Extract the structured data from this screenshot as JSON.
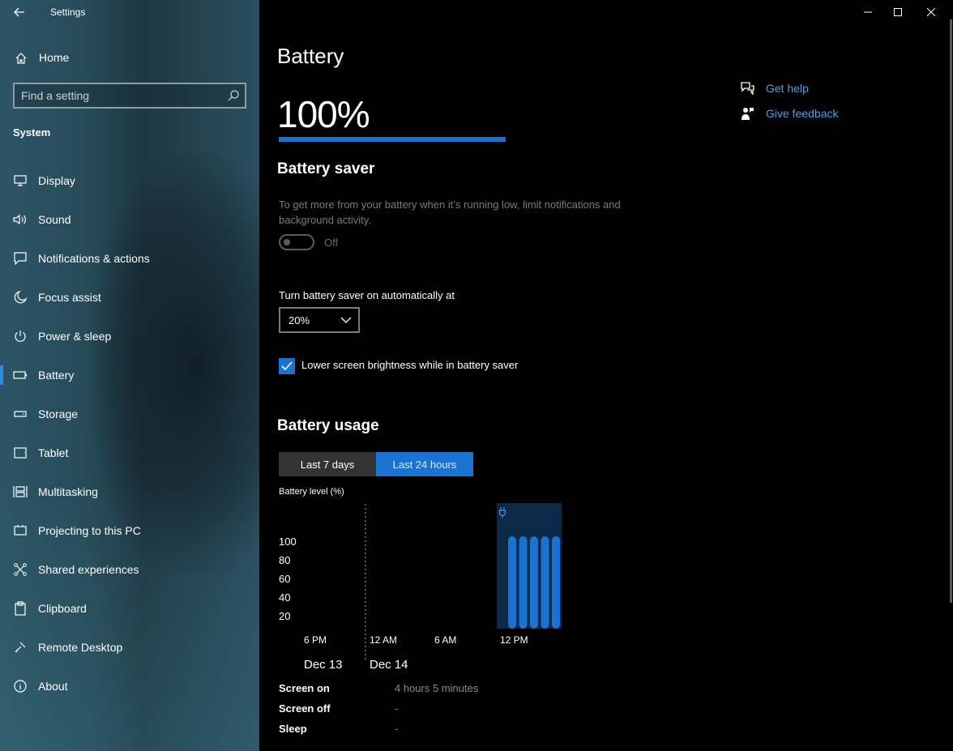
{
  "window": {
    "app_title": "Settings",
    "controls": [
      "minimize",
      "maximize",
      "close"
    ]
  },
  "sidebar": {
    "home_label": "Home",
    "search_placeholder": "Find a setting",
    "section": "System",
    "items": [
      {
        "label": "Display",
        "icon": "monitor-icon",
        "active": false
      },
      {
        "label": "Sound",
        "icon": "speaker-icon",
        "active": false
      },
      {
        "label": "Notifications & actions",
        "icon": "notification-icon",
        "active": false
      },
      {
        "label": "Focus assist",
        "icon": "moon-icon",
        "active": false
      },
      {
        "label": "Power & sleep",
        "icon": "power-icon",
        "active": false
      },
      {
        "label": "Battery",
        "icon": "battery-icon",
        "active": true
      },
      {
        "label": "Storage",
        "icon": "storage-icon",
        "active": false
      },
      {
        "label": "Tablet",
        "icon": "tablet-icon",
        "active": false
      },
      {
        "label": "Multitasking",
        "icon": "multitasking-icon",
        "active": false
      },
      {
        "label": "Projecting to this PC",
        "icon": "projector-icon",
        "active": false
      },
      {
        "label": "Shared experiences",
        "icon": "share-icon",
        "active": false
      },
      {
        "label": "Clipboard",
        "icon": "clipboard-icon",
        "active": false
      },
      {
        "label": "Remote Desktop",
        "icon": "remote-desktop-icon",
        "active": false
      },
      {
        "label": "About",
        "icon": "info-icon",
        "active": false
      }
    ]
  },
  "main": {
    "title": "Battery",
    "battery_percent_text": "100%",
    "battery_level": 1.0,
    "help_links": [
      {
        "label": "Get help",
        "icon": "help-icon"
      },
      {
        "label": "Give feedback",
        "icon": "feedback-icon"
      }
    ],
    "battery_saver": {
      "heading": "Battery saver",
      "description": "To get more from your battery when it’s running low, limit notifications and background activity.",
      "toggle_state": "Off",
      "auto_label": "Turn battery saver on automatically at",
      "auto_value": "20%",
      "brightness_label": "Lower screen brightness while in battery saver",
      "brightness_checked": true
    },
    "usage": {
      "heading": "Battery usage",
      "tabs": [
        {
          "label": "Last 7 days",
          "selected": false
        },
        {
          "label": "Last 24 hours",
          "selected": true
        }
      ],
      "stats": [
        {
          "label": "Screen on",
          "value": "4 hours 5 minutes"
        },
        {
          "label": "Screen off",
          "value": "-"
        },
        {
          "label": "Sleep",
          "value": "-"
        }
      ]
    }
  },
  "chart_data": {
    "type": "bar",
    "ylabel": "Battery level (%)",
    "yticks": [
      100,
      80,
      60,
      40,
      20
    ],
    "ylim": [
      0,
      100
    ],
    "xticks": [
      "6 PM",
      "12 AM",
      "6 AM",
      "12 PM"
    ],
    "dates": [
      "Dec 13",
      "Dec 14"
    ],
    "values": [
      100,
      100,
      100,
      100,
      100
    ],
    "charging": true,
    "colors": {
      "bar": "#1a73d1",
      "plugged_bg": "#0b2a4a"
    }
  }
}
